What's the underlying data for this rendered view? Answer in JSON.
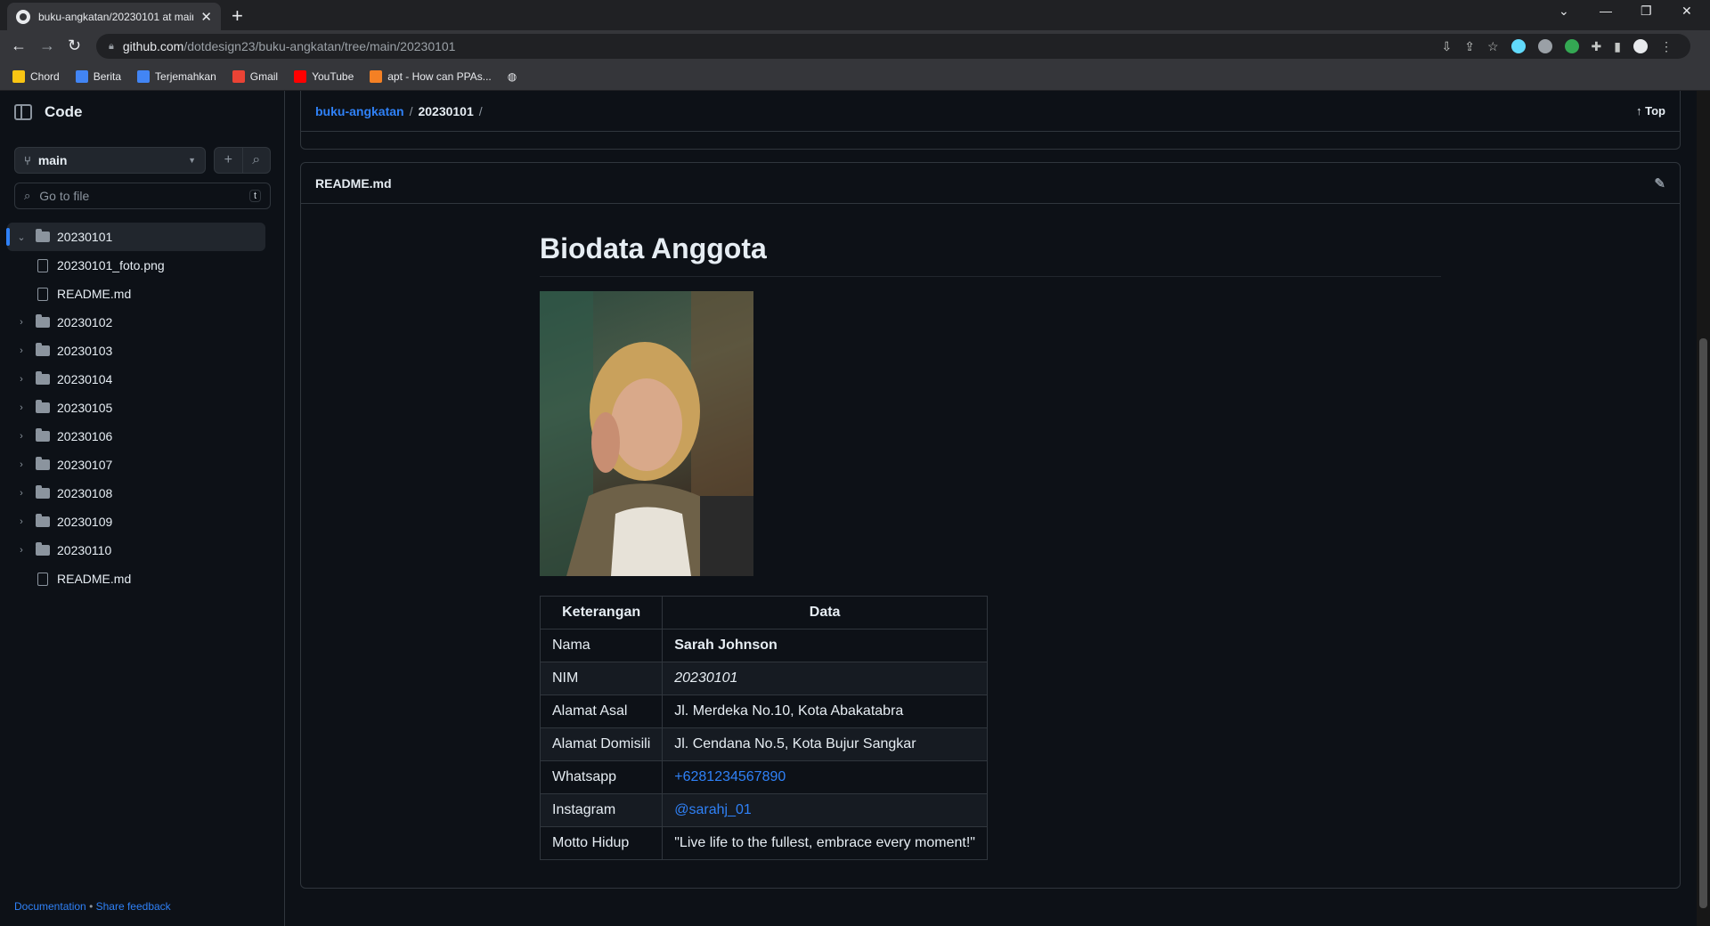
{
  "browser": {
    "tab_title": "buku-angkatan/20230101 at main",
    "tab_close": "✕",
    "new_tab": "+",
    "url_host": "github.com",
    "url_path": "/dotdesign23/buku-angkatan/tree/main/20230101",
    "bookmarks": [
      {
        "label": "Chord",
        "color": "#f9c513"
      },
      {
        "label": "Berita",
        "color": "#4285f4"
      },
      {
        "label": "Terjemahkan",
        "color": "#4285f4"
      },
      {
        "label": "Gmail",
        "color": "#ea4335"
      },
      {
        "label": "YouTube",
        "color": "#ff0000"
      },
      {
        "label": "apt - How can PPAs...",
        "color": "#f48024"
      }
    ]
  },
  "sidebar": {
    "title": "Code",
    "branch": "main",
    "go_to_file_placeholder": "Go to file",
    "shortcut_key": "t",
    "tree": [
      {
        "label": "20230101",
        "type": "folder",
        "expanded": true,
        "selected": true,
        "depth": 0
      },
      {
        "label": "20230101_foto.png",
        "type": "file",
        "depth": 1
      },
      {
        "label": "README.md",
        "type": "file",
        "depth": 1
      },
      {
        "label": "20230102",
        "type": "folder",
        "depth": 0
      },
      {
        "label": "20230103",
        "type": "folder",
        "depth": 0
      },
      {
        "label": "20230104",
        "type": "folder",
        "depth": 0
      },
      {
        "label": "20230105",
        "type": "folder",
        "depth": 0
      },
      {
        "label": "20230106",
        "type": "folder",
        "depth": 0
      },
      {
        "label": "20230107",
        "type": "folder",
        "depth": 0
      },
      {
        "label": "20230108",
        "type": "folder",
        "depth": 0
      },
      {
        "label": "20230109",
        "type": "folder",
        "depth": 0
      },
      {
        "label": "20230110",
        "type": "folder",
        "depth": 0
      },
      {
        "label": "README.md",
        "type": "file",
        "depth": 0
      }
    ],
    "footer_documentation": "Documentation",
    "footer_separator": "•",
    "footer_feedback": "Share feedback"
  },
  "breadcrumb": {
    "repo": "buku-angkatan",
    "sep": "/",
    "current": "20230101",
    "trailing_sep": "/",
    "top_label": "Top"
  },
  "readme": {
    "filename": "README.md",
    "heading": "Biodata Anggota",
    "table": {
      "headers": [
        "Keterangan",
        "Data"
      ],
      "rows": [
        {
          "label": "Nama",
          "value": "Sarah Johnson",
          "style": "bold"
        },
        {
          "label": "NIM",
          "value": "20230101",
          "style": "italic"
        },
        {
          "label": "Alamat Asal",
          "value": "Jl. Merdeka No.10, Kota Abakatabra",
          "style": "plain"
        },
        {
          "label": "Alamat Domisili",
          "value": "Jl. Cendana No.5, Kota Bujur Sangkar",
          "style": "plain"
        },
        {
          "label": "Whatsapp",
          "value": "+6281234567890",
          "style": "link"
        },
        {
          "label": "Instagram",
          "value": "@sarahj_01",
          "style": "link"
        },
        {
          "label": "Motto Hidup",
          "value": "\"Live life to the fullest, embrace every moment!\"",
          "style": "plain"
        }
      ]
    }
  },
  "colors": {
    "accent": "#2f81f7",
    "background": "#0d1117",
    "border": "#30363d"
  }
}
